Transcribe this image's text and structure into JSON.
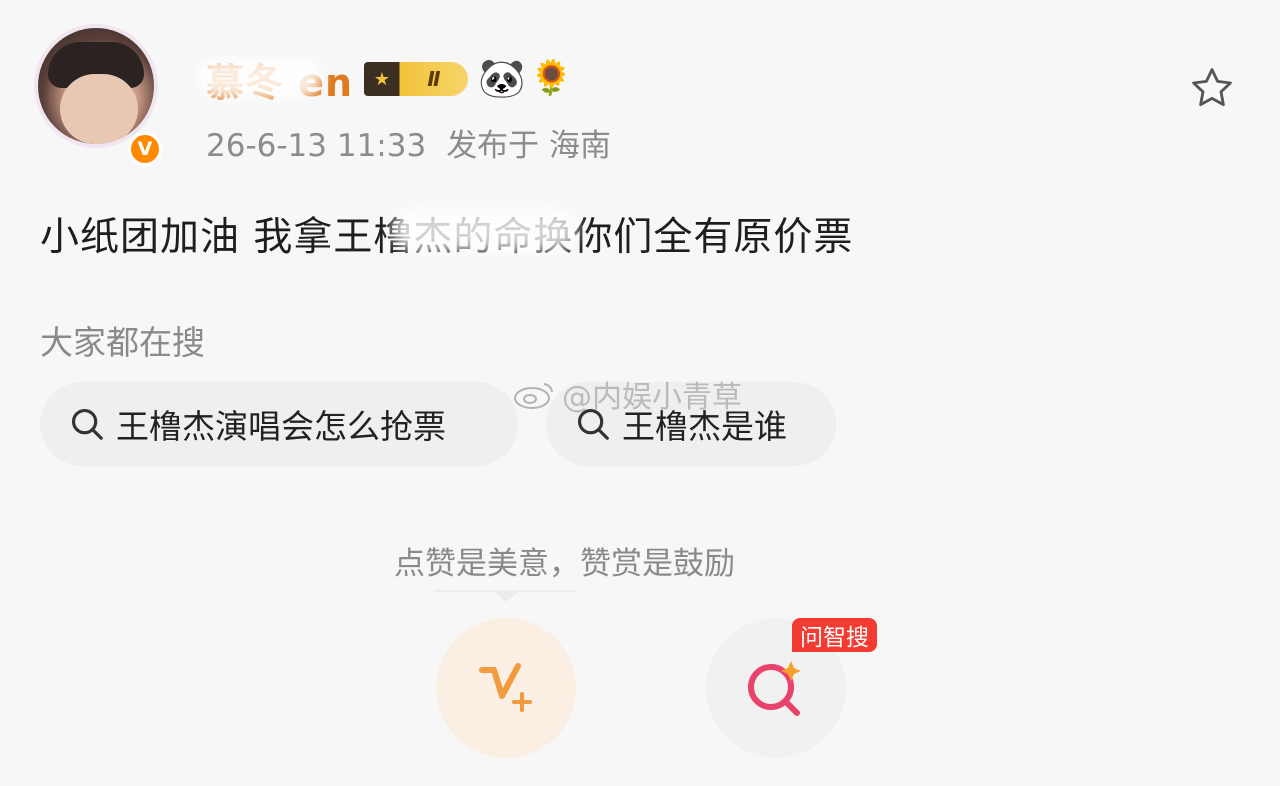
{
  "post": {
    "username": "慕冬 en",
    "level_badge": "Ⅱ",
    "emoji_1": "🐼",
    "emoji_2": "🌻",
    "time": "26-6-13 11:33",
    "location": "发布于 海南",
    "verified_mark": "V",
    "text": "小纸团加油 我拿王橹杰的命换你们全有原价票"
  },
  "search_section": {
    "title": "大家都在搜",
    "chips": [
      {
        "label": "王橹杰演唱会怎么抢票"
      },
      {
        "label": "王橹杰是谁"
      }
    ]
  },
  "watermark": {
    "text": "@内娱小青草"
  },
  "reward": {
    "encourage_text": "点赞是美意，赞赏是鼓励",
    "ai_search_tag": "问智搜"
  },
  "colors": {
    "username": "#e07a1f",
    "accent_orange": "#ff8a00",
    "tag_red": "#f23b31",
    "ai_icon_pink": "#e8436b"
  },
  "icons": [
    "verified-icon",
    "star-icon",
    "search-icon",
    "weibo-icon",
    "vplus-icon",
    "ai-search-icon"
  ]
}
